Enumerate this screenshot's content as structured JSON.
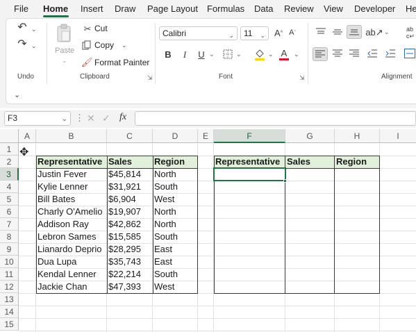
{
  "menubar": {
    "items": [
      "File",
      "Home",
      "Insert",
      "Draw",
      "Page Layout",
      "Formulas",
      "Data",
      "Review",
      "View",
      "Developer",
      "He"
    ],
    "active": "Home"
  },
  "ribbon": {
    "undo": {
      "label": "Undo"
    },
    "clipboard": {
      "label": "Clipboard",
      "paste": "Paste",
      "cut": "Cut",
      "copy": "Copy",
      "format_painter": "Format Painter"
    },
    "font": {
      "label": "Font",
      "name": "Calibri",
      "size": "11",
      "bold": "B",
      "italic": "I",
      "underline": "U",
      "font_color_glyph": "A"
    },
    "alignment": {
      "label": "Alignment"
    }
  },
  "formula_bar": {
    "name_box": "F3",
    "formula": ""
  },
  "sheet": {
    "columns": [
      "A",
      "B",
      "C",
      "D",
      "E",
      "F",
      "G",
      "H",
      "I"
    ],
    "selected_column": "F",
    "rows": [
      "1",
      "2",
      "3",
      "4",
      "5",
      "6",
      "7",
      "8",
      "9",
      "10",
      "11",
      "12",
      "13",
      "14",
      "15"
    ],
    "selected_row": "3",
    "table1": {
      "headers": [
        "Representative",
        "Sales",
        "Region"
      ],
      "rows": [
        [
          "Justin Fever",
          "$45,814",
          "North"
        ],
        [
          "Kylie Lenner",
          "$31,921",
          "South"
        ],
        [
          "Bill Bates",
          "$6,904",
          "West"
        ],
        [
          "Charly O'Amelio",
          "$19,907",
          "North"
        ],
        [
          "Addison Ray",
          "$42,862",
          "North"
        ],
        [
          "Lebron Sames",
          "$15,585",
          "South"
        ],
        [
          "Lianardo Deprio",
          "$28,295",
          "East"
        ],
        [
          "Dua Lupa",
          "$35,743",
          "East"
        ],
        [
          "Kendal Lenner",
          "$22,214",
          "South"
        ],
        [
          "Jackie Chan",
          "$47,393",
          "West"
        ]
      ]
    },
    "table2": {
      "headers": [
        "Representative",
        "Sales",
        "Region"
      ]
    },
    "active_cell": "F3",
    "header_fill_color": "#e2efda",
    "accent_color": "#217346"
  }
}
